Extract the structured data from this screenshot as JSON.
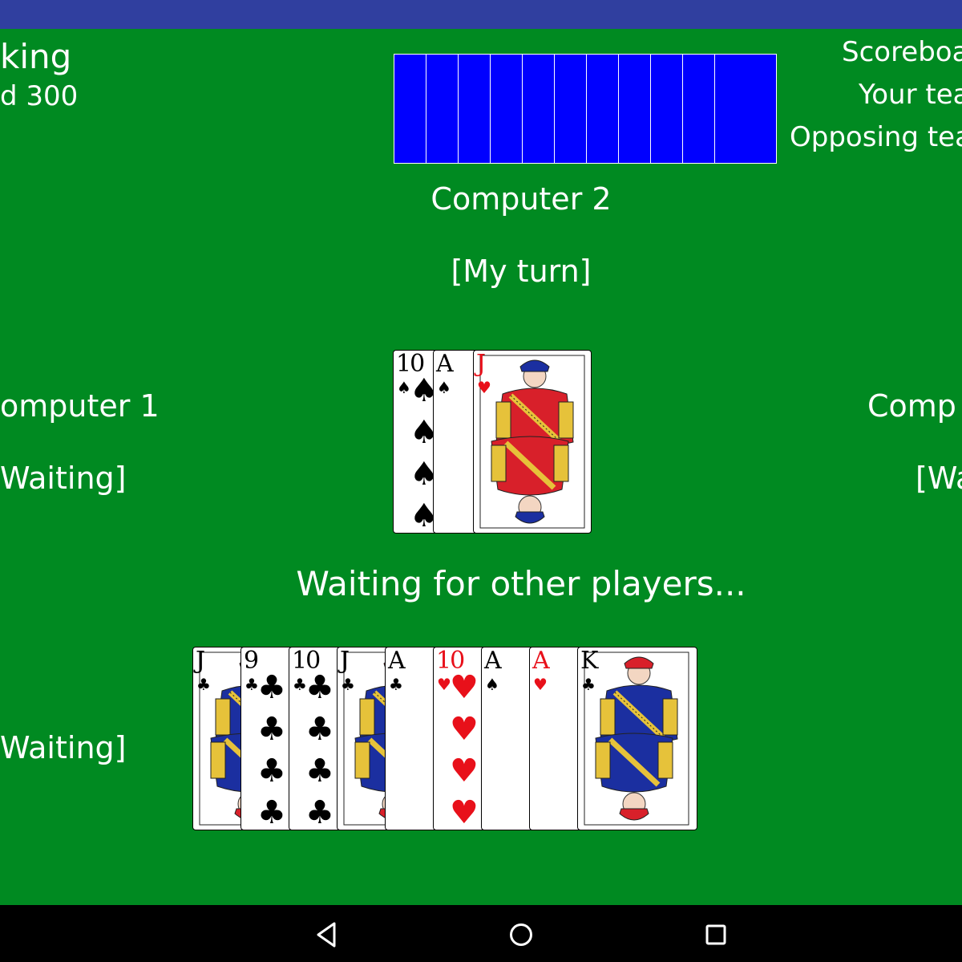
{
  "top_left": {
    "line1": "king",
    "line2": "d 300"
  },
  "scoreboard": {
    "title": "Scoreboa",
    "your_team": "Your tea",
    "opposing_team": "Opposing tea"
  },
  "players": {
    "top": {
      "name": "Computer 2",
      "status": "[My turn]",
      "cards_in_hand": 11
    },
    "left": {
      "name": "omputer 1",
      "status": "Waiting]"
    },
    "right": {
      "name": "Comp",
      "status": "[Wa"
    },
    "bottom": {
      "status": "Waiting]"
    }
  },
  "message": "Waiting for other players...",
  "trick": [
    {
      "rank": "10",
      "suit": "spades",
      "suit_glyph": "♠",
      "color": "black"
    },
    {
      "rank": "A",
      "suit": "spades",
      "suit_glyph": "♠",
      "color": "black"
    },
    {
      "rank": "J",
      "suit": "hearts",
      "suit_glyph": "♥",
      "color": "red"
    }
  ],
  "hand": [
    {
      "rank": "J",
      "suit": "clubs",
      "suit_glyph": "♣",
      "color": "black"
    },
    {
      "rank": "9",
      "suit": "clubs",
      "suit_glyph": "♣",
      "color": "black"
    },
    {
      "rank": "10",
      "suit": "clubs",
      "suit_glyph": "♣",
      "color": "black"
    },
    {
      "rank": "J",
      "suit": "clubs",
      "suit_glyph": "♣",
      "color": "black"
    },
    {
      "rank": "A",
      "suit": "clubs",
      "suit_glyph": "♣",
      "color": "black"
    },
    {
      "rank": "10",
      "suit": "hearts",
      "suit_glyph": "♥",
      "color": "red"
    },
    {
      "rank": "A",
      "suit": "spades",
      "suit_glyph": "♠",
      "color": "black"
    },
    {
      "rank": "A",
      "suit": "hearts",
      "suit_glyph": "♥",
      "color": "red"
    },
    {
      "rank": "K",
      "suit": "clubs",
      "suit_glyph": "♣",
      "color": "black"
    }
  ],
  "nav": {
    "back": "back-icon",
    "home": "home-icon",
    "recents": "recents-icon"
  },
  "colors": {
    "felt": "#008a21",
    "status_bar": "#303f9f",
    "card_back": "#0000ff",
    "red_suit": "#e8101a"
  }
}
